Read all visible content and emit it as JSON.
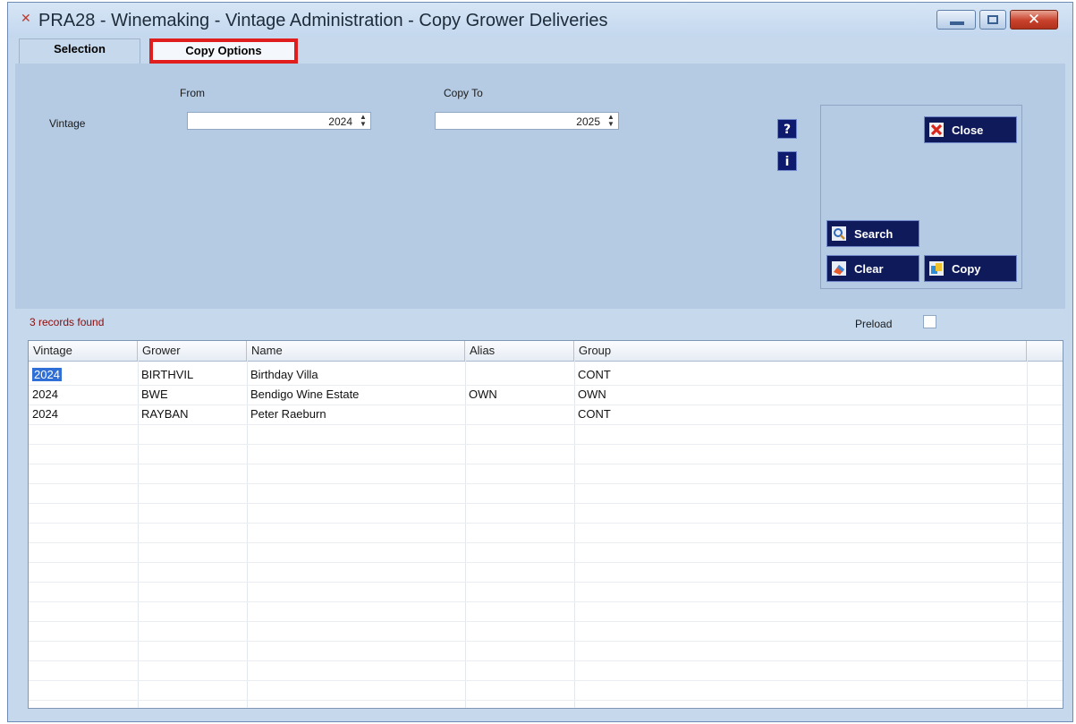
{
  "window": {
    "title": "PRA28 - Winemaking - Vintage Administration - Copy Grower Deliveries",
    "close_glyph": "✕"
  },
  "tabs": [
    {
      "label": "Selection"
    },
    {
      "label": "Copy Options"
    }
  ],
  "form": {
    "from_label": "From",
    "copyto_label": "Copy To",
    "vintage_label": "Vintage",
    "from_value": "2024",
    "copyto_value": "2025"
  },
  "icons": {
    "help_glyph": "?",
    "info_glyph": "i"
  },
  "buttons": {
    "close": "Close",
    "search": "Search",
    "clear": "Clear",
    "copy": "Copy"
  },
  "status": "3 records found",
  "preload_label": "Preload",
  "grid": {
    "columns": [
      "Vintage",
      "Grower",
      "Name",
      "Alias",
      "Group"
    ],
    "rows": [
      [
        "2024",
        "BIRTHVIL",
        "Birthday Villa",
        "",
        "CONT"
      ],
      [
        "2024",
        "BWE",
        "Bendigo Wine Estate",
        "OWN",
        "OWN"
      ],
      [
        "2024",
        "RAYBAN",
        "Peter Raeburn",
        "",
        "CONT"
      ]
    ]
  },
  "colors": {
    "highlight_border": "#e01e1e",
    "button_bg": "#0f1a5a",
    "panel_bg": "#b5cbe3",
    "selected_cell": "#2f6fd6"
  }
}
